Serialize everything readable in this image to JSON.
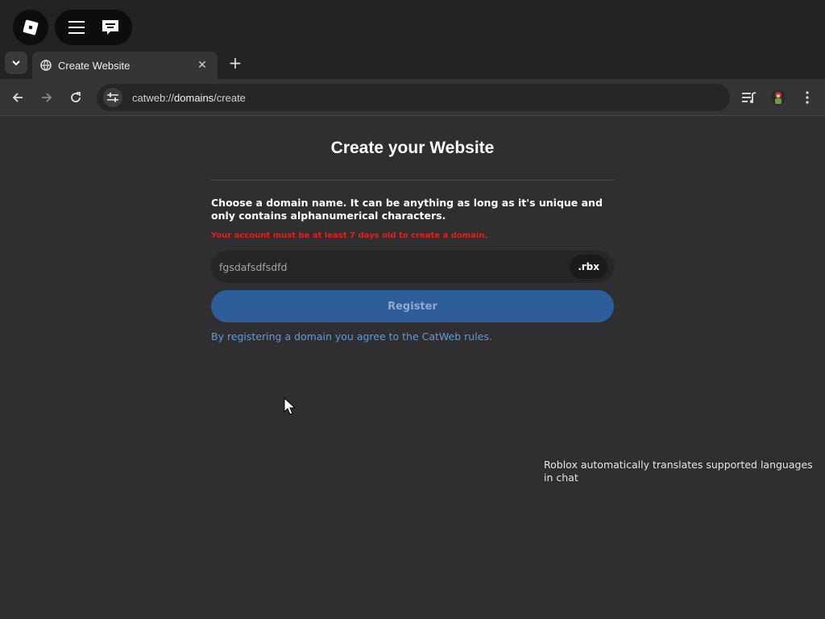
{
  "tab": {
    "title": "Create Website"
  },
  "toolbar": {
    "url_scheme": "catweb://",
    "url_host": "domains",
    "url_path": "/create"
  },
  "page": {
    "title": "Create your Website",
    "instructions": "Choose a domain name. It can be anything as long as it's unique and only contains alphanumerical characters.",
    "error": "Your account must be at least 7 days old to create a domain.",
    "domain_value": "fgsdafsdfsdfd",
    "tld": ".rbx",
    "register_label": "Register",
    "rules_link": "By registering a domain you agree to the CatWeb rules."
  },
  "overlay": {
    "translate_note": "Roblox automatically translates supported languages in chat"
  },
  "colors": {
    "error": "#e0201c",
    "link": "#5b9be0",
    "button": "#2e5e9a"
  }
}
